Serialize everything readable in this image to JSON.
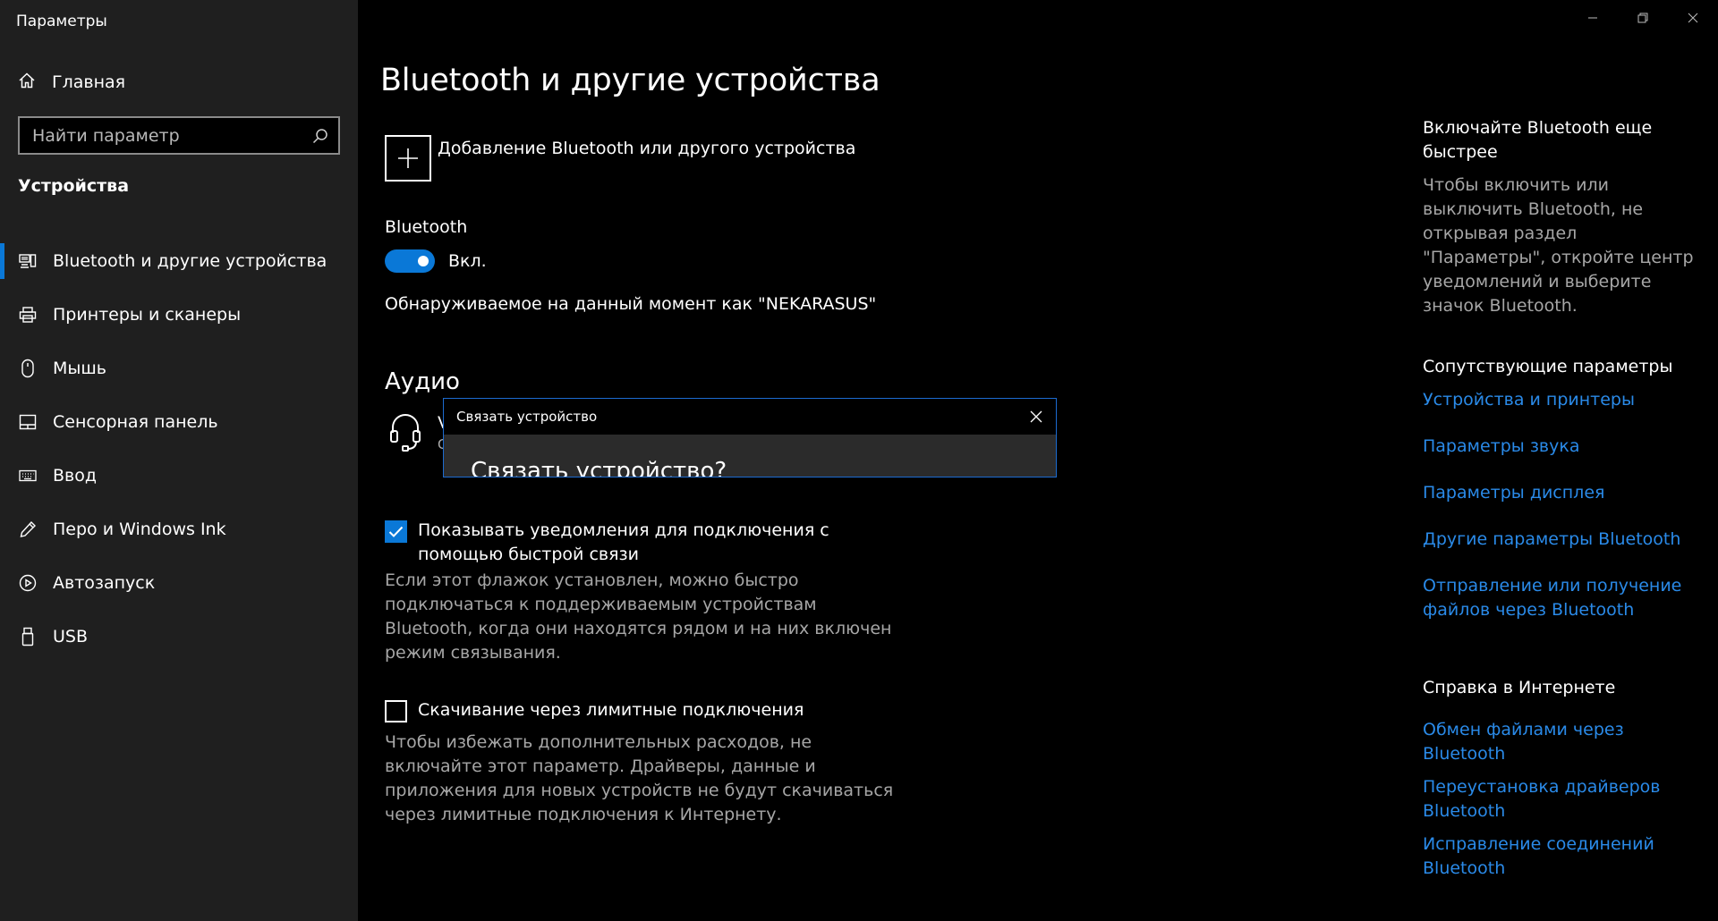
{
  "window": {
    "title": "Параметры"
  },
  "sidebar": {
    "home_label": "Главная",
    "search_placeholder": "Найти параметр",
    "section_title": "Устройства",
    "items": [
      {
        "label": "Bluetooth и другие устройства",
        "icon": "devices-icon",
        "active": true
      },
      {
        "label": "Принтеры и сканеры",
        "icon": "printer-icon"
      },
      {
        "label": "Мышь",
        "icon": "mouse-icon"
      },
      {
        "label": "Сенсорная панель",
        "icon": "touchpad-icon"
      },
      {
        "label": "Ввод",
        "icon": "keyboard-icon"
      },
      {
        "label": "Перо и Windows Ink",
        "icon": "pen-icon"
      },
      {
        "label": "Автозапуск",
        "icon": "autoplay-icon"
      },
      {
        "label": "USB",
        "icon": "usb-icon"
      }
    ]
  },
  "main": {
    "title": "Bluetooth и другие устройства",
    "add_device_label": "Добавление Bluetooth или другого устройства",
    "bluetooth_label": "Bluetooth",
    "toggle_state": "Вкл.",
    "discoverable_text": "Обнаруживаемое на данный момент как \"NEKARASUS\"",
    "audio_title": "Аудио",
    "audio_fragment_1": "V",
    "audio_fragment_2": "C",
    "swift_pair": {
      "label": "Показывать уведомления для подключения с помощью быстрой связи",
      "checked": true,
      "description": "Если этот флажок установлен, можно быстро подключаться к поддерживаемым устройствам Bluetooth, когда они находятся рядом и на них включен режим связывания."
    },
    "metered": {
      "label": "Скачивание через лимитные подключения",
      "checked": false,
      "description": "Чтобы избежать дополнительных расходов, не включайте этот параметр. Драйверы, данные и приложения для новых устройств не будут скачиваться через лимитные подключения к Интернету."
    }
  },
  "dialog": {
    "title": "Связать устройство",
    "heading": "Связать устройство?"
  },
  "right": {
    "tip_title": "Включайте Bluetooth еще быстрее",
    "tip_text": "Чтобы включить или выключить Bluetooth, не открывая раздел \"Параметры\", откройте центр уведомлений и выберите значок Bluetooth.",
    "related_title": "Сопутствующие параметры",
    "related_links": [
      "Устройства и принтеры",
      "Параметры звука",
      "Параметры дисплея",
      "Другие параметры Bluetooth",
      "Отправление или получение файлов через Bluetooth"
    ],
    "help_title": "Справка в Интернете",
    "help_links": [
      "Обмен файлами через Bluetooth",
      "Переустановка драйверов Bluetooth",
      "Исправление соединений Bluetooth"
    ]
  },
  "colors": {
    "accent": "#0a78d7",
    "link": "#2a8ae8",
    "sidebar_bg": "#1f1f1f",
    "secondary_text": "#a6a6a6"
  }
}
